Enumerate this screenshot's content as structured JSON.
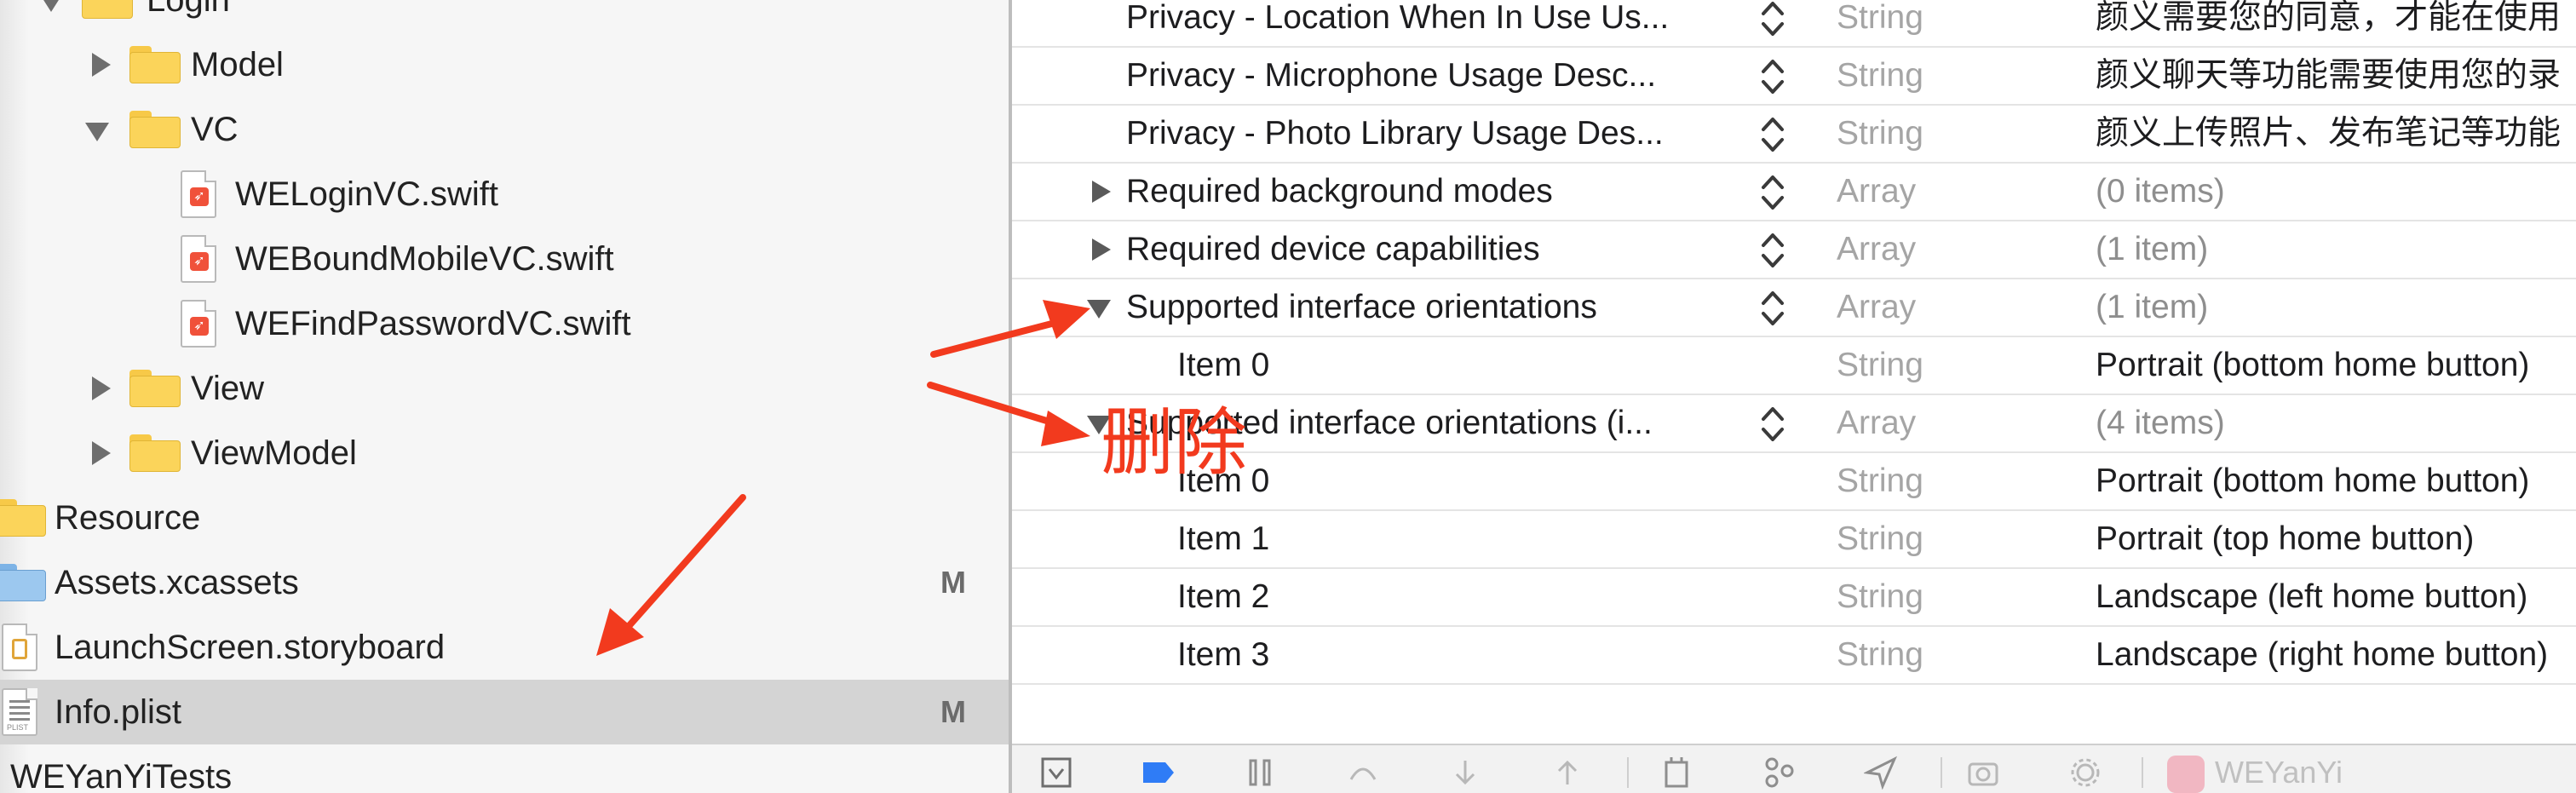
{
  "navigator": {
    "items": [
      {
        "label": "Login",
        "kind": "folder",
        "expanded": true
      },
      {
        "label": "Model",
        "kind": "folder",
        "expanded": false
      },
      {
        "label": "VC",
        "kind": "folder",
        "expanded": true
      },
      {
        "label": "WELoginVC.swift",
        "kind": "swift-file"
      },
      {
        "label": "WEBoundMobileVC.swift",
        "kind": "swift-file"
      },
      {
        "label": "WEFindPasswordVC.swift",
        "kind": "swift-file"
      },
      {
        "label": "View",
        "kind": "folder",
        "expanded": false
      },
      {
        "label": "ViewModel",
        "kind": "folder",
        "expanded": false
      },
      {
        "label": "Resource",
        "kind": "folder"
      },
      {
        "label": "Assets.xcassets",
        "kind": "asset-catalog",
        "badge": "M"
      },
      {
        "label": "LaunchScreen.storyboard",
        "kind": "storyboard-file"
      },
      {
        "label": "Info.plist",
        "kind": "plist-file",
        "badge": "M",
        "selected": true
      },
      {
        "label": "WEYanYiTests",
        "kind": "group"
      }
    ]
  },
  "plist": {
    "rows": [
      {
        "key": "Privacy - Location When In Use Us...",
        "type": "String",
        "value": "颜义需要您的同意，才能在使用"
      },
      {
        "key": "Privacy - Microphone Usage Desc...",
        "type": "String",
        "value": "颜义聊天等功能需要使用您的录"
      },
      {
        "key": "Privacy - Photo Library Usage Des...",
        "type": "String",
        "value": "颜义上传照片、发布笔记等功能"
      },
      {
        "key": "Required background modes",
        "type": "Array",
        "value": "(0 items)",
        "disclosure": "closed"
      },
      {
        "key": "Required device capabilities",
        "type": "Array",
        "value": "(1 item)",
        "disclosure": "closed"
      },
      {
        "key": "Supported interface orientations",
        "type": "Array",
        "value": "(1 item)",
        "disclosure": "open"
      },
      {
        "key": "Item 0",
        "type": "String",
        "value": "Portrait (bottom home button)",
        "child": true
      },
      {
        "key": "Supported interface orientations (i...",
        "type": "Array",
        "value": "(4 items)",
        "disclosure": "open"
      },
      {
        "key": "Item 0",
        "type": "String",
        "value": "Portrait (bottom home button)",
        "child": true
      },
      {
        "key": "Item 1",
        "type": "String",
        "value": "Portrait (top home button)",
        "child": true
      },
      {
        "key": "Item 2",
        "type": "String",
        "value": "Landscape (left home button)",
        "child": true
      },
      {
        "key": "Item 3",
        "type": "String",
        "value": "Landscape (right home button)",
        "child": true
      }
    ]
  },
  "debug_bar": {
    "target_app": "WEYanYi",
    "icons": [
      "hide-debug-area-icon",
      "breakpoints-icon",
      "pause-icon",
      "step-over-icon",
      "step-into-icon",
      "step-out-icon",
      "view-hierarchy-icon",
      "memory-graph-icon",
      "simulate-location-icon",
      "screenshot-icon",
      "environment-overrides-icon"
    ]
  },
  "annotation": {
    "delete_label": "删除",
    "arrow_color": "#f23a1e"
  },
  "colors": {
    "selection": "#d4d4d4",
    "folder": "#fbd45a",
    "swift": "#f0513a",
    "type_text": "#a5a5a5"
  }
}
